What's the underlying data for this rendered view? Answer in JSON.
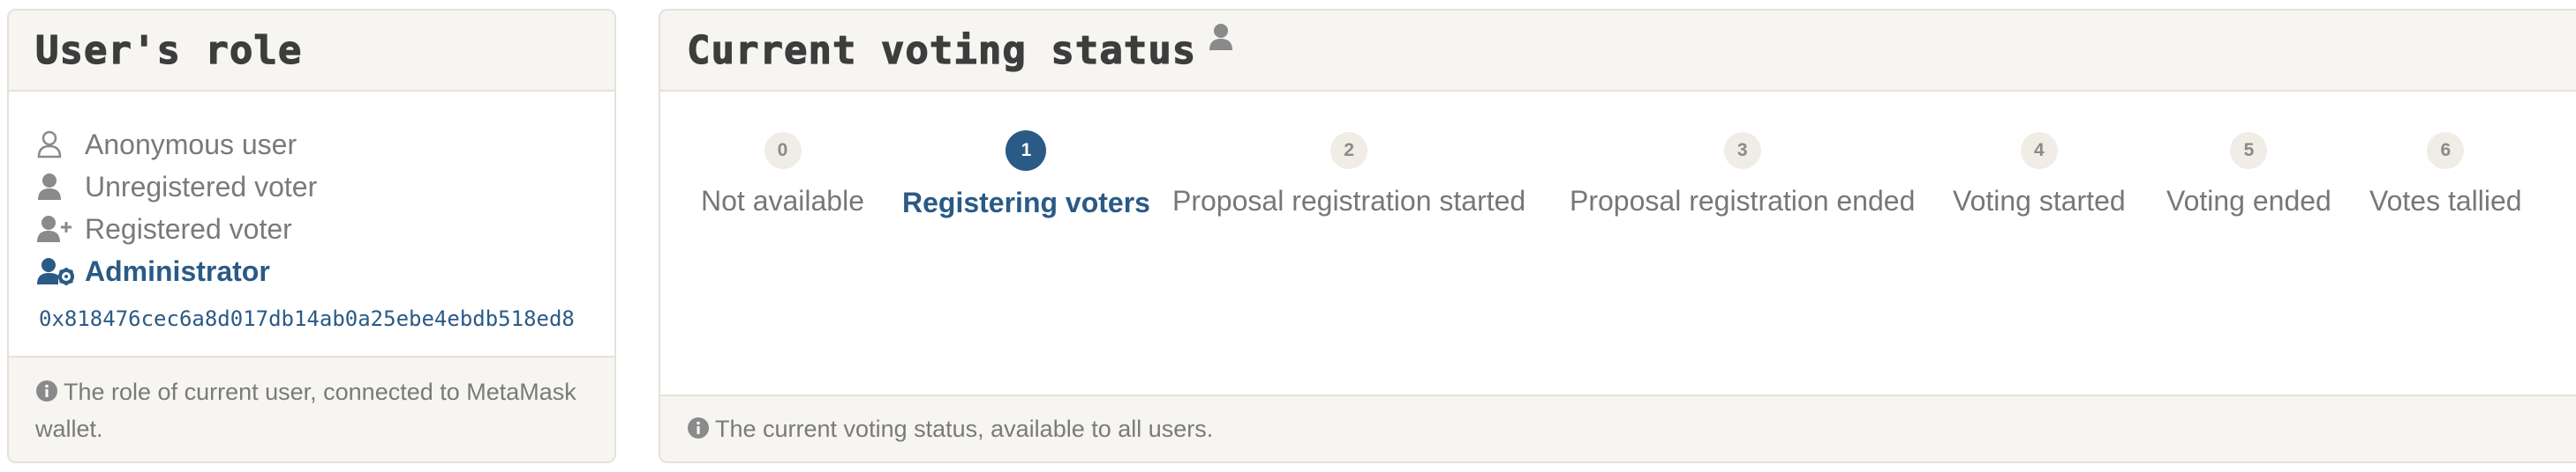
{
  "role_panel": {
    "title": "User's role",
    "roles": [
      {
        "label": "Anonymous user",
        "icon": "user-outline-icon",
        "active": false
      },
      {
        "label": "Unregistered voter",
        "icon": "user-icon",
        "active": false
      },
      {
        "label": "Registered voter",
        "icon": "user-plus-icon",
        "active": false
      },
      {
        "label": "Administrator",
        "icon": "user-gear-icon",
        "active": true
      }
    ],
    "address": "0x818476cec6a8d017db14ab0a25ebe4ebdb518ed8",
    "footer_text": "The role of current user, connected to MetaMask wallet."
  },
  "status_panel": {
    "title": "Current voting status",
    "title_icon": "user-icon",
    "steps": [
      {
        "number": "0",
        "label": "Not available",
        "active": false
      },
      {
        "number": "1",
        "label": "Registering voters",
        "active": true
      },
      {
        "number": "2",
        "label": "Proposal registration started",
        "active": false
      },
      {
        "number": "3",
        "label": "Proposal registration ended",
        "active": false
      },
      {
        "number": "4",
        "label": "Voting started",
        "active": false
      },
      {
        "number": "5",
        "label": "Voting ended",
        "active": false
      },
      {
        "number": "6",
        "label": "Votes tallied",
        "active": false
      }
    ],
    "footer_text": "The current voting status, available to all users."
  },
  "colors": {
    "accent": "#2a5a86",
    "muted": "#777777",
    "panel_bg": "#f7f5f2",
    "border": "#e6e1da"
  }
}
